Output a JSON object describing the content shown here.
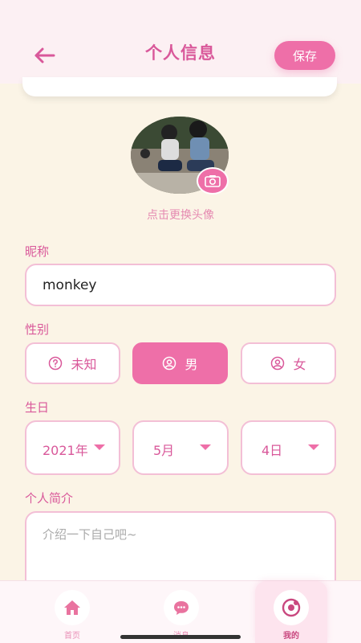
{
  "header": {
    "title": "个人信息",
    "save_label": "保存"
  },
  "avatar": {
    "hint": "点击更换头像"
  },
  "nickname": {
    "label": "昵称",
    "value": "monkey"
  },
  "gender": {
    "label": "性别",
    "options": [
      {
        "label": "未知",
        "icon": "question-circle-icon",
        "selected": false
      },
      {
        "label": "男",
        "icon": "person-circle-icon",
        "selected": true
      },
      {
        "label": "女",
        "icon": "person-circle-icon",
        "selected": false
      }
    ]
  },
  "birthday": {
    "label": "生日",
    "year": "2021年",
    "month": "5月",
    "day": "4日"
  },
  "bio": {
    "label": "个人简介",
    "placeholder": "介绍一下自己吧~"
  },
  "tabbar": {
    "items": [
      {
        "label": "首页",
        "icon": "home-icon",
        "active": false
      },
      {
        "label": "消息",
        "icon": "chat-bubble-icon",
        "active": false
      },
      {
        "label": "我的",
        "icon": "profile-icon",
        "active": true
      }
    ]
  },
  "colors": {
    "accent": "#ee6fa8",
    "title": "#d9589a",
    "background": "#fbf4e6",
    "border": "#f3bfd6"
  }
}
